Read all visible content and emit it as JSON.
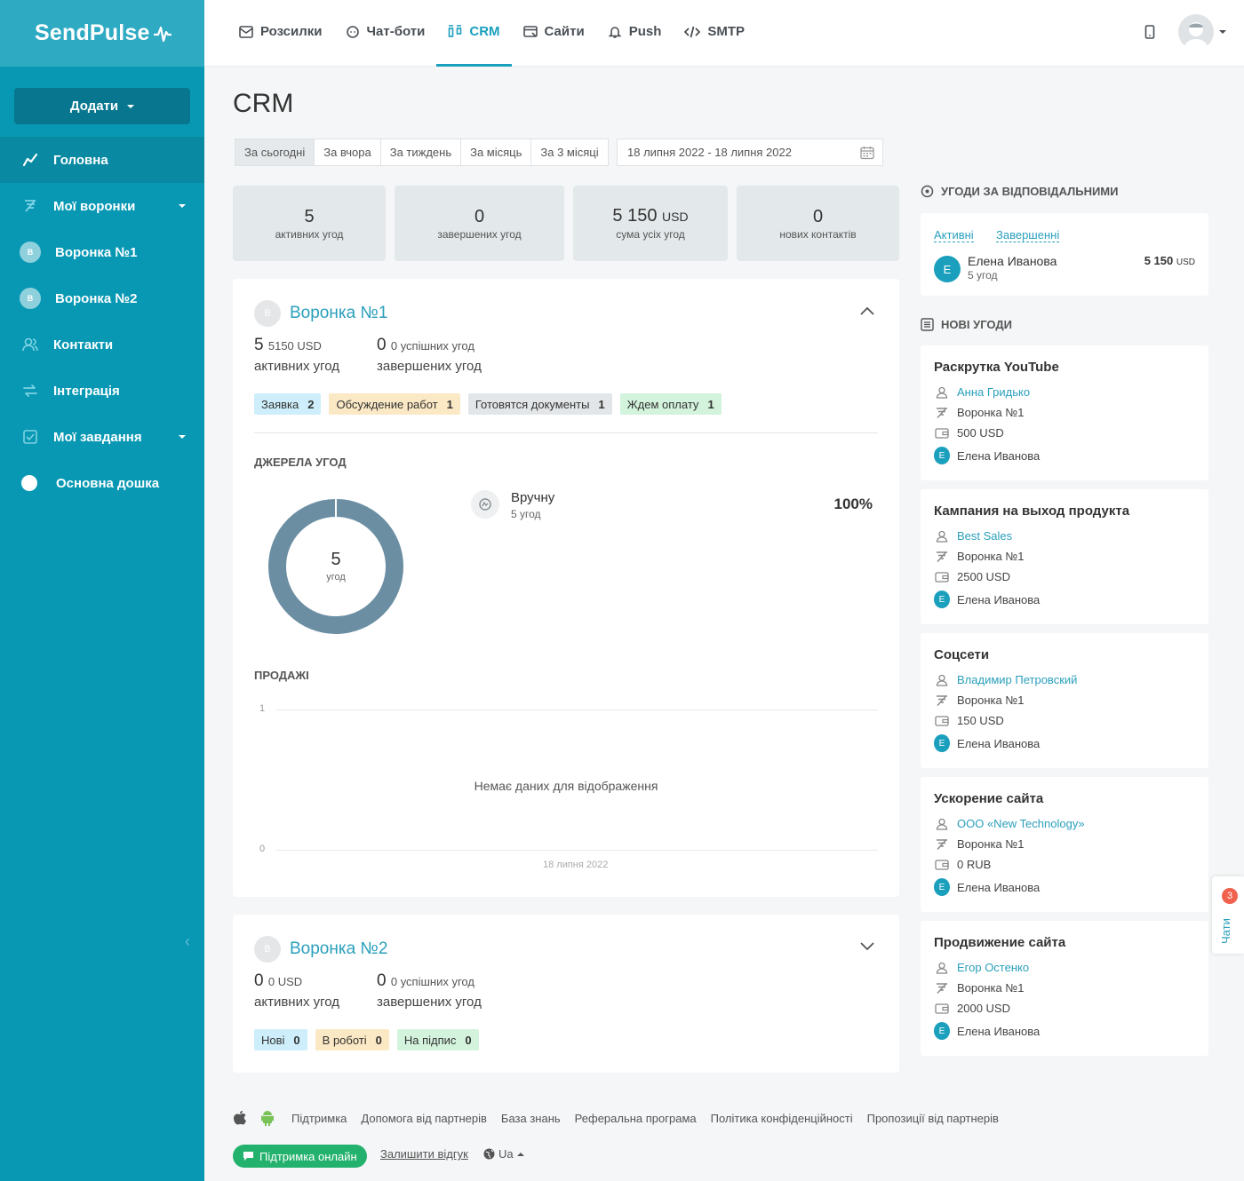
{
  "sidebar": {
    "logo": "SendPulse",
    "add_label": "Додати",
    "items": [
      {
        "label": "Головна",
        "icon": "chart-line-icon"
      },
      {
        "label": "Мої воронки",
        "icon": "funnel-icon"
      },
      {
        "label": "Воронка №1",
        "badge": "В"
      },
      {
        "label": "Воронка №2",
        "badge": "В"
      },
      {
        "label": "Контакти",
        "icon": "contacts-icon"
      },
      {
        "label": "Інтеграція",
        "icon": "integration-icon"
      },
      {
        "label": "Мої завдання",
        "icon": "tasks-icon"
      },
      {
        "label": "Основна дошка",
        "icon": "board-dot-icon"
      }
    ]
  },
  "topnav": {
    "tabs": [
      {
        "label": "Розсилки"
      },
      {
        "label": "Чат-боти"
      },
      {
        "label": "CRM"
      },
      {
        "label": "Сайти"
      },
      {
        "label": "Push"
      },
      {
        "label": "SMTP"
      }
    ]
  },
  "page": {
    "title": "CRM",
    "periods": [
      "За сьогодні",
      "За вчора",
      "За тиждень",
      "За місяць",
      "За 3 місяці"
    ],
    "date_range": "18 липня 2022 - 18 липня 2022"
  },
  "stats": [
    {
      "value": "5",
      "unit": "",
      "label": "активних угод"
    },
    {
      "value": "0",
      "unit": "",
      "label": "завершених угод"
    },
    {
      "value": "5 150",
      "unit": "USD",
      "label": "сума усіх угод"
    },
    {
      "value": "0",
      "unit": "",
      "label": "нових контактів"
    }
  ],
  "funnel1": {
    "badge": "В",
    "title": "Воронка №1",
    "active_count": "5",
    "active_sum": "5150 USD",
    "active_label": "активних угод",
    "done_count": "0",
    "done_sub": "0 успішних угод",
    "done_label": "завершених угод",
    "stages": [
      {
        "name": "Заявка",
        "count": "2",
        "color": "#cdeefa"
      },
      {
        "name": "Обсуждение работ",
        "count": "1",
        "color": "#fbe8c4"
      },
      {
        "name": "Готовятся документы",
        "count": "1",
        "color": "#e3e6e8"
      },
      {
        "name": "Ждем оплату",
        "count": "1",
        "color": "#d3f3dd"
      }
    ],
    "sources_title": "Джерела угод",
    "donut_value": "5",
    "donut_label": "угод",
    "source_name": "Вручну",
    "source_sub": "5 угод",
    "source_pct": "100%",
    "sales_title": "Продажі",
    "sales_empty": "Немає даних для відображення",
    "sales_y_top": "1",
    "sales_y_bottom": "0",
    "sales_x": "18 липня 2022"
  },
  "funnel2": {
    "badge": "В",
    "title": "Воронка №2",
    "active_count": "0",
    "active_sum": "0 USD",
    "active_label": "активних угод",
    "done_count": "0",
    "done_sub": "0 успішних угод",
    "done_label": "завершених угод",
    "stages": [
      {
        "name": "Нові",
        "count": "0",
        "color": "#cdeefa"
      },
      {
        "name": "В роботі",
        "count": "0",
        "color": "#fbe8c4"
      },
      {
        "name": "На підпис",
        "count": "0",
        "color": "#d3f3dd"
      }
    ]
  },
  "responsible": {
    "title": "Угоди за відповідальними",
    "tab_active": "Активні",
    "tab_done": "Завершенні",
    "badge": "Е",
    "name": "Елена Иванова",
    "deals": "5 угод",
    "sum": "5 150",
    "sum_unit": "USD"
  },
  "new_deals": {
    "title": "Нові угоди",
    "items": [
      {
        "title": "Раскрутка YouTube",
        "contact": "Анна Гридько",
        "funnel": "Воронка №1",
        "amount": "500 USD",
        "badge": "Е",
        "owner": "Елена Иванова"
      },
      {
        "title": "Кампания на выход продукта",
        "contact": "Best Sales",
        "funnel": "Воронка №1",
        "amount": "2500 USD",
        "badge": "Е",
        "owner": "Елена Иванова"
      },
      {
        "title": "Соцсети",
        "contact": "Владимир Петровский",
        "funnel": "Воронка №1",
        "amount": "150 USD",
        "badge": "Е",
        "owner": "Елена Иванова"
      },
      {
        "title": "Ускорение сайта",
        "contact": "ООО «New Technology»",
        "funnel": "Воронка №1",
        "amount": "0 RUB",
        "badge": "Е",
        "owner": "Елена Иванова"
      },
      {
        "title": "Продвижение сайта",
        "contact": "Егор Остенко",
        "funnel": "Воронка №1",
        "amount": "2000 USD",
        "badge": "Е",
        "owner": "Елена Иванова"
      }
    ]
  },
  "footer": {
    "links": [
      "Підтримка",
      "Допомога від партнерів",
      "База знань",
      "Реферальна програма",
      "Політика конфіденційності",
      "Пропозиції від партнерів"
    ],
    "support_btn": "Підтримка онлайн",
    "feedback": "Залишити відгук",
    "lang": "Ua"
  },
  "chats": {
    "label": "Чати",
    "count": "3"
  },
  "colors": {
    "sidebar": "#0898b4",
    "accent": "#1a9fbd",
    "donut": "#6b8ea3",
    "support": "#23b26d"
  }
}
